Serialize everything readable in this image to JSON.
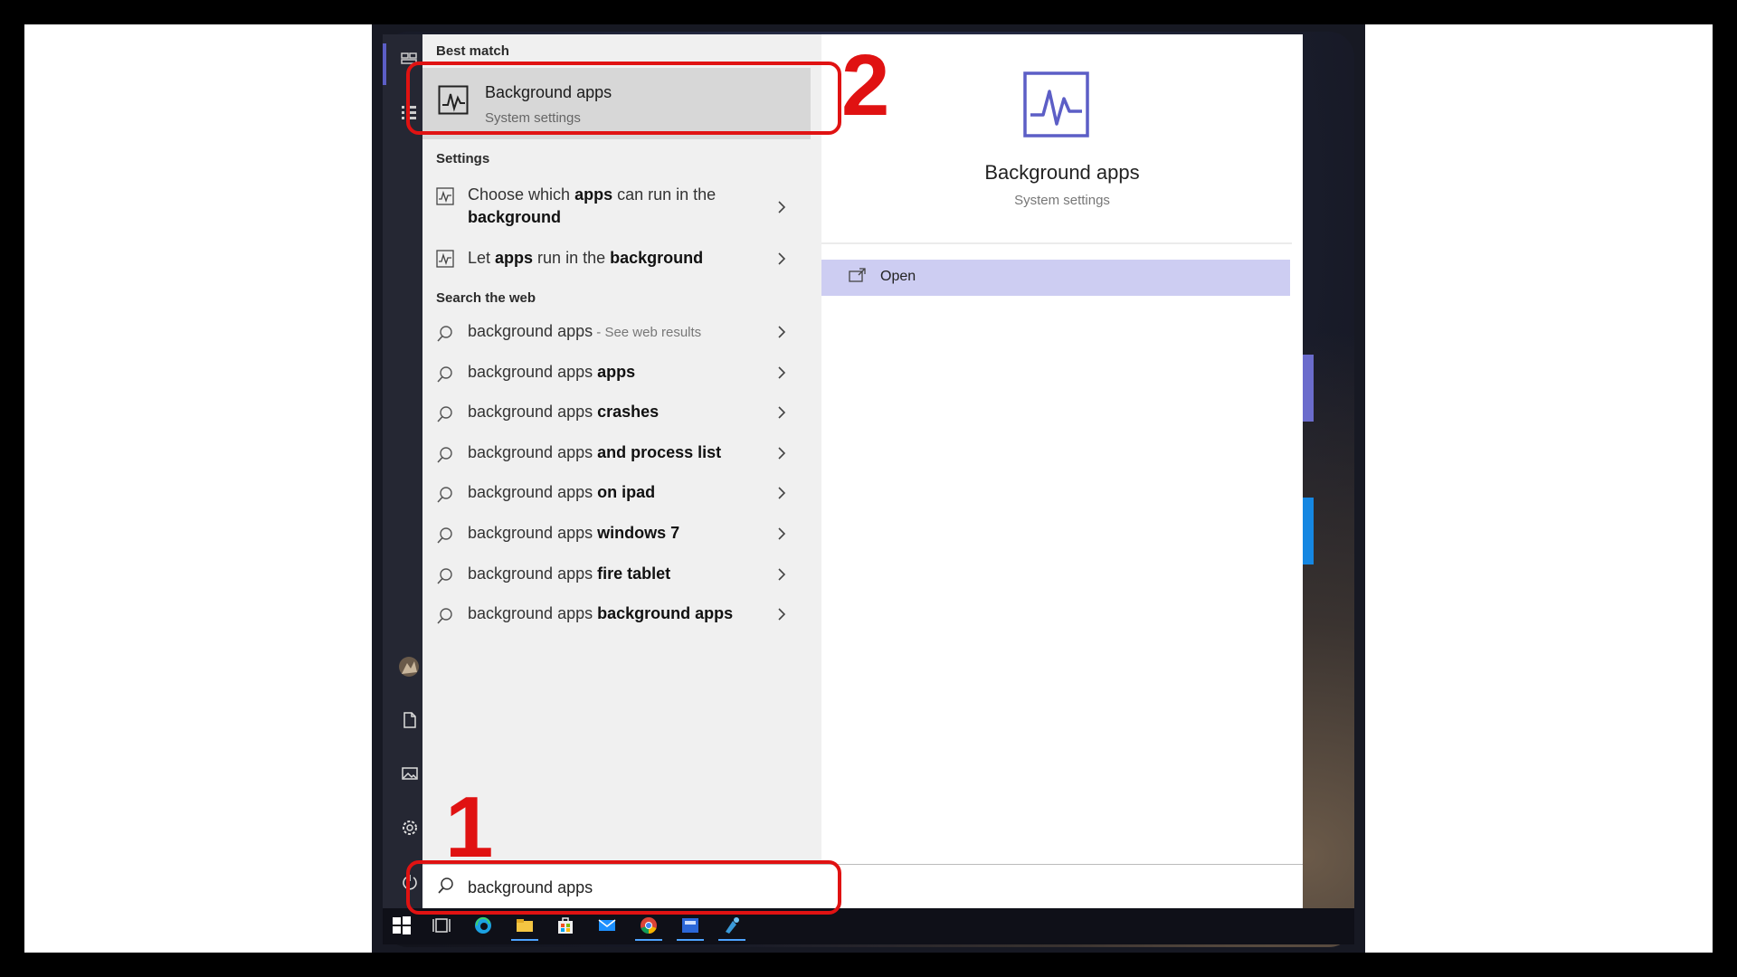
{
  "search_panel": {
    "best_match": {
      "header": "Best match",
      "title": "Background apps",
      "subtitle": "System settings"
    },
    "settings": {
      "header": "Settings",
      "items": [
        {
          "line1_pre": "Choose which ",
          "line1_bold": "apps",
          "line1_post": " can run in the",
          "line2_bold": "background"
        },
        {
          "pre": "Let ",
          "bold1": "apps",
          "mid": " run in the ",
          "bold2": "background"
        }
      ]
    },
    "web": {
      "header": "Search the web",
      "items": [
        {
          "base": "background apps",
          "bold": "",
          "suffix": " - See web results"
        },
        {
          "base": "background apps ",
          "bold": "apps",
          "suffix": ""
        },
        {
          "base": "background apps ",
          "bold": "crashes",
          "suffix": ""
        },
        {
          "base": "background apps ",
          "bold": "and process list",
          "suffix": ""
        },
        {
          "base": "background apps ",
          "bold": "on ipad",
          "suffix": ""
        },
        {
          "base": "background apps ",
          "bold": "windows 7",
          "suffix": ""
        },
        {
          "base": "background apps ",
          "bold": "fire tablet",
          "suffix": ""
        },
        {
          "base": "background apps ",
          "bold": "background apps",
          "suffix": ""
        }
      ]
    }
  },
  "detail": {
    "title": "Background apps",
    "subtitle": "System settings",
    "open_label": "Open"
  },
  "search": {
    "value": "background apps"
  },
  "annotations": {
    "step1": "1",
    "step2": "2",
    "color": "#e01212"
  },
  "colors": {
    "accent": "#5c5ec6",
    "open_highlight": "#cdcdf2"
  },
  "icons": {
    "rail": [
      "tiles-icon",
      "list-icon",
      "user-avatar-icon",
      "document-icon",
      "pictures-icon",
      "settings-gear-icon",
      "power-icon"
    ],
    "taskbar": [
      "windows-start-icon",
      "task-view-icon",
      "edge-icon",
      "file-explorer-icon",
      "store-icon",
      "mail-icon",
      "chrome-icon",
      "app-icon",
      "paint-icon"
    ]
  }
}
